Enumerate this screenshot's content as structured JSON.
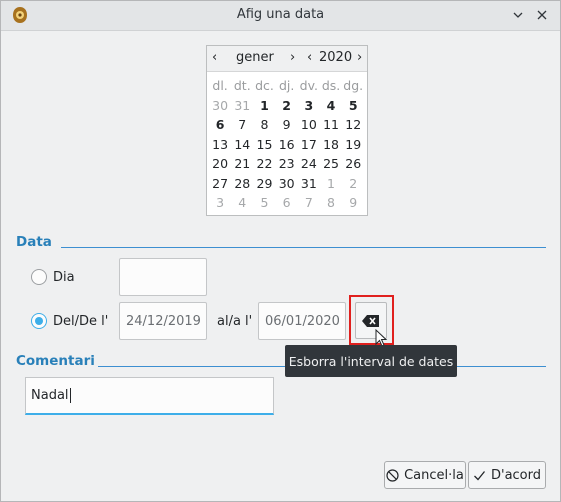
{
  "window": {
    "title": "Afig una data"
  },
  "calendar": {
    "month": "gener",
    "year": "2020",
    "weekdays": [
      "dl.",
      "dt.",
      "dc.",
      "dj.",
      "dv.",
      "ds.",
      "dg."
    ],
    "days": [
      [
        "30",
        "31",
        "1",
        "2",
        "3",
        "4",
        "5"
      ],
      [
        "6",
        "7",
        "8",
        "9",
        "10",
        "11",
        "12"
      ],
      [
        "13",
        "14",
        "15",
        "16",
        "17",
        "18",
        "19"
      ],
      [
        "20",
        "21",
        "22",
        "23",
        "24",
        "25",
        "26"
      ],
      [
        "27",
        "28",
        "29",
        "30",
        "31",
        "1",
        "2"
      ],
      [
        "3",
        "4",
        "5",
        "6",
        "7",
        "8",
        "9"
      ]
    ]
  },
  "date_section": {
    "header": "Data",
    "day_label": "Dia",
    "day_value": "",
    "range_label": "Del/De l'",
    "range_from": "24/12/2019",
    "range_to_label": "al/a l'",
    "range_to": "06/01/2020",
    "clear_tooltip": "Esborra l'interval de dates"
  },
  "comment_section": {
    "header": "Comentari",
    "value": "Nadal"
  },
  "buttons": {
    "cancel": "Cancel·la",
    "ok": "D'acord"
  }
}
